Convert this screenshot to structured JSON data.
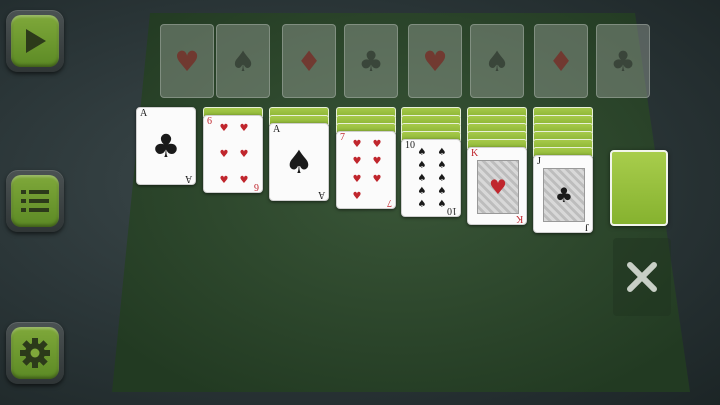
{
  "colors": {
    "felt": "#2f4a2e",
    "accent": "#7fa83a",
    "card_back": "#98c13f",
    "red_suit": "#c0262d",
    "black_suit": "#1a1a1a"
  },
  "side_buttons": [
    {
      "name": "play-icon"
    },
    {
      "name": "menu-icon"
    },
    {
      "name": "gear-icon"
    }
  ],
  "foundations": [
    {
      "suit": "♥",
      "color": "red"
    },
    {
      "suit": "♠",
      "color": "black"
    },
    {
      "suit": "♦",
      "color": "red"
    },
    {
      "suit": "♣",
      "color": "black"
    },
    {
      "suit": "♥",
      "color": "red"
    },
    {
      "suit": "♠",
      "color": "black"
    },
    {
      "suit": "♦",
      "color": "red"
    },
    {
      "suit": "♣",
      "color": "black"
    }
  ],
  "tableau": [
    {
      "rank": "A",
      "suit": "♣",
      "color": "black",
      "hidden": 0
    },
    {
      "rank": "6",
      "suit": "♥",
      "color": "red",
      "hidden": 1
    },
    {
      "rank": "A",
      "suit": "♠",
      "color": "black",
      "hidden": 2
    },
    {
      "rank": "7",
      "suit": "♥",
      "color": "red",
      "hidden": 3
    },
    {
      "rank": "10",
      "suit": "♠",
      "color": "black",
      "hidden": 4
    },
    {
      "rank": "K",
      "suit": "♥",
      "color": "red",
      "hidden": 5
    },
    {
      "rank": "J",
      "suit": "♣",
      "color": "black",
      "hidden": 6
    }
  ],
  "stock": {
    "label": ""
  },
  "waste": {
    "icon": "close-icon"
  }
}
